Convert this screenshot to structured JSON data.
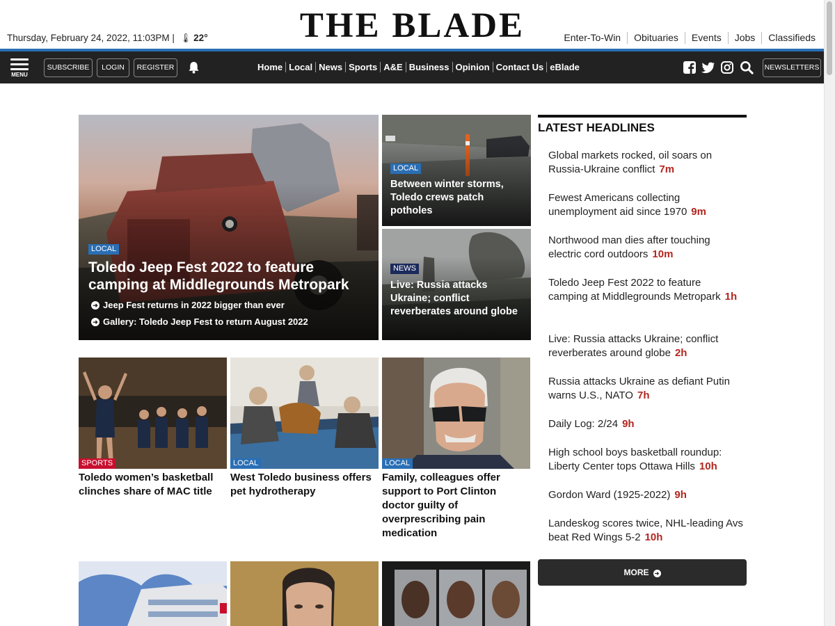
{
  "header": {
    "date": "Thursday, February 24, 2022, 11:03PM |",
    "temperature": "22°",
    "logo": "THE BLADE",
    "top_links": [
      "Enter-To-Win",
      "Obituaries",
      "Events",
      "Jobs",
      "Classifieds"
    ]
  },
  "navbar": {
    "menu_label": "MENU",
    "subscribe": "SUBSCRIBE",
    "login": "LOGIN",
    "register": "REGISTER",
    "links": [
      "Home",
      "Local",
      "News",
      "Sports",
      "A&E",
      "Business",
      "Opinion",
      "Contact Us",
      "eBlade"
    ],
    "newsletters": "NEWSLETTERS",
    "social_icons": [
      "facebook-icon",
      "twitter-icon",
      "instagram-icon",
      "search-icon"
    ]
  },
  "lead": {
    "tag": "LOCAL",
    "title": "Toledo Jeep Fest 2022 to feature camping at Middlegrounds Metropark",
    "related": [
      "Jeep Fest returns in 2022 bigger than ever",
      "Gallery: Toledo Jeep Fest to return August 2022"
    ]
  },
  "secondary": [
    {
      "tag": "LOCAL",
      "title": "Between winter storms, Toledo crews patch potholes"
    },
    {
      "tag": "NEWS",
      "title": "Live: Russia attacks Ukraine; conflict reverberates around globe"
    }
  ],
  "grid": [
    {
      "tag": "SPORTS",
      "title": "Toledo women’s basketball clinches share of MAC title"
    },
    {
      "tag": "LOCAL",
      "title": "West Toledo business offers pet hydrotherapy"
    },
    {
      "tag": "LOCAL",
      "title": "Family, colleagues offer support to Port Clinton doctor guilty of overprescribing pain medication"
    }
  ],
  "sidebar": {
    "heading": "LATEST HEADLINES",
    "items": [
      {
        "text": "Global markets rocked, oil soars on Russia-Ukraine conflict",
        "ago": "7m"
      },
      {
        "text": "Fewest Americans collecting unemployment aid since 1970",
        "ago": "9m"
      },
      {
        "text": "Northwood man dies after touching electric cord outdoors",
        "ago": "10m"
      },
      {
        "text": "Toledo Jeep Fest 2022 to feature camping at Middlegrounds Metropark",
        "ago": "1h"
      },
      {
        "text": "Live: Russia attacks Ukraine; conflict reverberates around globe",
        "ago": "2h"
      },
      {
        "text": "Russia attacks Ukraine as defiant Putin warns U.S., NATO",
        "ago": "7h"
      },
      {
        "text": "Daily Log: 2/24",
        "ago": "9h"
      },
      {
        "text": "High school boys basketball roundup: Liberty Center tops Ottawa Hills",
        "ago": "10h"
      },
      {
        "text": "Gordon Ward (1925-2022)",
        "ago": "9h"
      },
      {
        "text": "Landeskog scores twice, NHL-leading Avs beat Red Wings 5-2",
        "ago": "10h"
      }
    ],
    "more_label": "MORE"
  },
  "colors": {
    "accent_blue": "#2a6fb5",
    "nav_bg": "#222222",
    "time_red": "#b2261f",
    "sports_red": "#c8102e"
  }
}
